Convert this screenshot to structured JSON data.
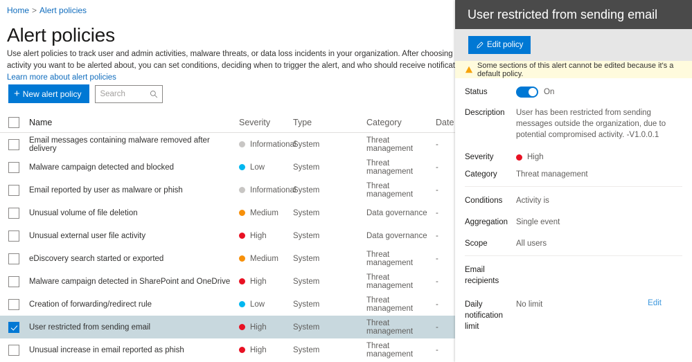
{
  "breadcrumb": {
    "home": "Home",
    "separator": ">",
    "current": "Alert policies"
  },
  "page": {
    "title": "Alert policies",
    "description": "Use alert policies to track user and admin activities, malware threats, or data loss incidents in your organization. After choosing the activity you want to be alerted about, you can set conditions, deciding when to trigger the alert, and who should receive notifications.",
    "learn_more": "Learn more about alert policies"
  },
  "toolbar": {
    "new_policy_label": "New alert policy",
    "new_policy_plus": "+",
    "search_placeholder": "Search",
    "search_value": ""
  },
  "table": {
    "headers": {
      "name": "Name",
      "severity": "Severity",
      "type": "Type",
      "category": "Category",
      "date": "Date m"
    },
    "rows": [
      {
        "name": "Email messages containing malware removed after delivery",
        "severity": "Informational",
        "severity_color": "#c8c6c4",
        "type": "System",
        "category": "Threat management",
        "date": "-",
        "selected": false
      },
      {
        "name": "Malware campaign detected and blocked",
        "severity": "Low",
        "severity_color": "#00b7f0",
        "type": "System",
        "category": "Threat management",
        "date": "-",
        "selected": false
      },
      {
        "name": "Email reported by user as malware or phish",
        "severity": "Informational",
        "severity_color": "#c8c6c4",
        "type": "System",
        "category": "Threat management",
        "date": "-",
        "selected": false
      },
      {
        "name": "Unusual volume of file deletion",
        "severity": "Medium",
        "severity_color": "#f7900a",
        "type": "System",
        "category": "Data governance",
        "date": "-",
        "selected": false
      },
      {
        "name": "Unusual external user file activity",
        "severity": "High",
        "severity_color": "#e81123",
        "type": "System",
        "category": "Data governance",
        "date": "-",
        "selected": false
      },
      {
        "name": "eDiscovery search started or exported",
        "severity": "Medium",
        "severity_color": "#f7900a",
        "type": "System",
        "category": "Threat management",
        "date": "-",
        "selected": false
      },
      {
        "name": "Malware campaign detected in SharePoint and OneDrive",
        "severity": "High",
        "severity_color": "#e81123",
        "type": "System",
        "category": "Threat management",
        "date": "-",
        "selected": false
      },
      {
        "name": "Creation of forwarding/redirect rule",
        "severity": "Low",
        "severity_color": "#00b7f0",
        "type": "System",
        "category": "Threat management",
        "date": "-",
        "selected": false
      },
      {
        "name": "User restricted from sending email",
        "severity": "High",
        "severity_color": "#e81123",
        "type": "System",
        "category": "Threat management",
        "date": "-",
        "selected": true
      },
      {
        "name": "Unusual increase in email reported as phish",
        "severity": "High",
        "severity_color": "#e81123",
        "type": "System",
        "category": "Threat management",
        "date": "-",
        "selected": false
      }
    ]
  },
  "panel": {
    "title": "User restricted from sending email",
    "edit_policy_label": "Edit policy",
    "warning": "Some sections of this alert cannot be edited because it's a default policy.",
    "fields": {
      "status_label": "Status",
      "status_value": "On",
      "description_label": "Description",
      "description_value": "User has been restricted from sending messages outside the organization, due to potential compromised activity. -V1.0.0.1",
      "severity_label": "Severity",
      "severity_value": "High",
      "severity_color": "#e81123",
      "category_label": "Category",
      "category_value": "Threat management",
      "conditions_label": "Conditions",
      "conditions_value": "Activity is",
      "aggregation_label": "Aggregation",
      "aggregation_value": "Single event",
      "scope_label": "Scope",
      "scope_value": "All users",
      "email_recipients_label": "Email recipients",
      "email_recipients_value": "",
      "daily_limit_label": "Daily notification limit",
      "daily_limit_value": "No limit",
      "edit_link": "Edit"
    }
  },
  "colors": {
    "accent": "#0078d4",
    "panel_header": "#4a4a4a",
    "toolbar_bg": "#e6e6e6",
    "warning_bg": "#fffbdd",
    "selected_row": "#c8d8de",
    "link": "#0f6cbd"
  }
}
